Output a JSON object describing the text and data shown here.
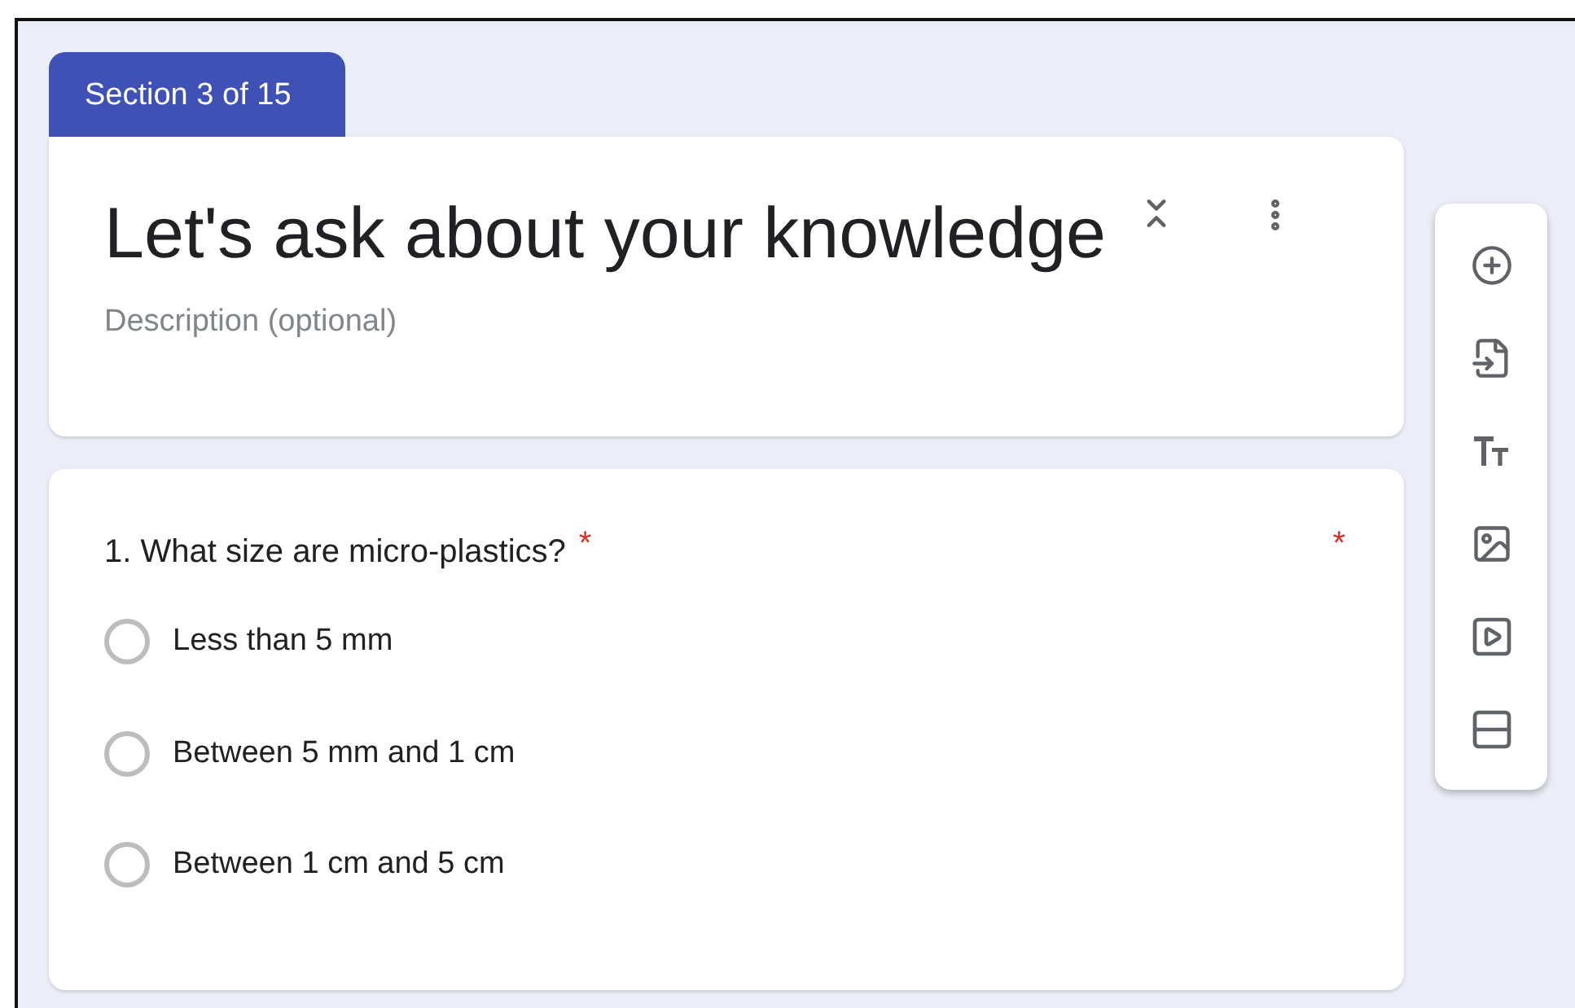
{
  "section_tab": {
    "label": "Section 3 of 15"
  },
  "section_card": {
    "title": "Let's ask about your knowledge",
    "description_placeholder": "Description (optional)"
  },
  "question": {
    "title": "1. What size are micro-plastics?",
    "required_mark": "*",
    "side_mark": "*",
    "options": [
      {
        "label": "Less than 5 mm",
        "selected": false
      },
      {
        "label": "Between 5 mm and 1 cm",
        "selected": false
      },
      {
        "label": "Between 1 cm and 5 cm",
        "selected": false
      }
    ]
  },
  "toolbar": [
    {
      "kind": "add"
    },
    {
      "kind": "import"
    },
    {
      "kind": "text"
    },
    {
      "kind": "image"
    },
    {
      "kind": "video"
    },
    {
      "kind": "section"
    }
  ]
}
